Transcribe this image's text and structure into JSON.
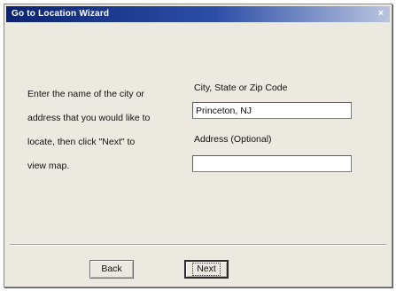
{
  "window": {
    "title": "Go to Location Wizard",
    "close_glyph": "×"
  },
  "instructions": {
    "lines": [
      "Enter the name of the city or",
      "address that you would like to",
      "locate, then click \"Next\" to",
      "view map."
    ]
  },
  "fields": {
    "city": {
      "label": "City, State or Zip Code",
      "value": "Princeton, NJ"
    },
    "address": {
      "label": "Address (Optional)",
      "value": ""
    }
  },
  "buttons": {
    "back": "Back",
    "next": "Next"
  }
}
